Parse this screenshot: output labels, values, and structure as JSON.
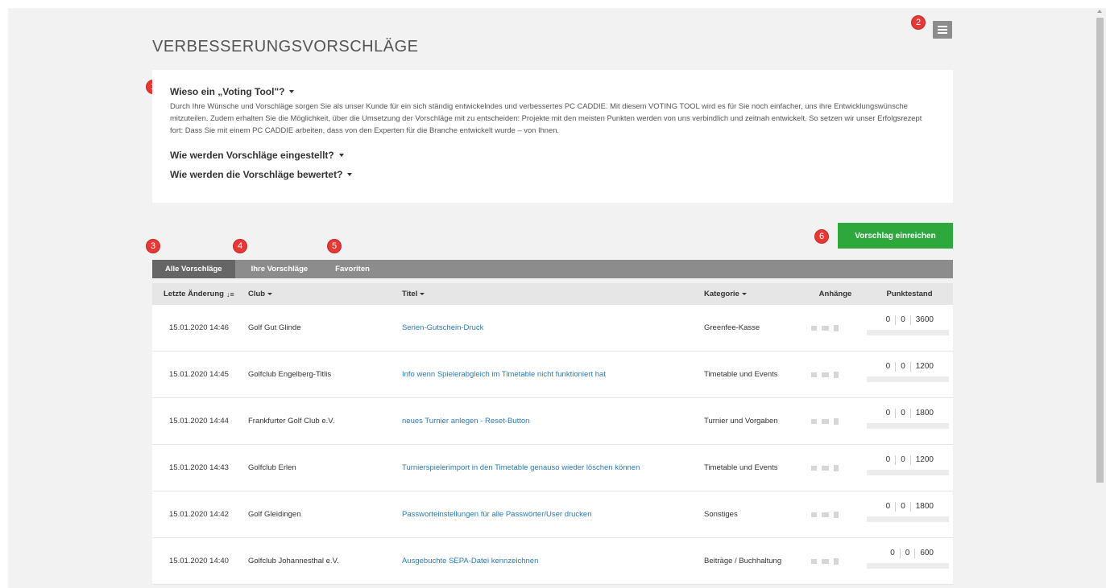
{
  "page": {
    "title": "VERBESSERUNGSVORSCHLÄGE"
  },
  "badges": [
    "1",
    "2",
    "3",
    "4",
    "5",
    "6"
  ],
  "faq": {
    "q1": "Wieso ein „Voting Tool\"?",
    "a1": "Durch Ihre Wünsche und Vorschläge sorgen Sie als unser Kunde für ein sich ständig entwickelndes und verbessertes PC CADDIE. Mit diesem VOTING TOOL wird es für Sie noch einfacher, uns ihre Entwicklungswünsche mitzuteilen. Zudem erhalten Sie die Möglichkeit, über die Umsetzung der Vorschläge mit zu entscheiden: Projekte mit den meisten Punkten werden von uns verbindlich und zeitnah entwickelt. So setzen wir unser Erfolgsrezept fort: Dass Sie mit einem PC CADDIE arbeiten, dass von den Experten für die Branche entwickelt wurde – von Ihnen.",
    "q2": "Wie werden Vorschläge eingestellt?",
    "q3": "Wie werden die Vorschläge bewertet?"
  },
  "submit_label": "Vorschlag einreichen",
  "tabs": [
    {
      "label": "Alle Vorschläge",
      "active": true
    },
    {
      "label": "Ihre Vorschläge",
      "active": false
    },
    {
      "label": "Favoriten",
      "active": false
    }
  ],
  "table": {
    "headers": {
      "date": "Letzte Änderung",
      "club": "Club",
      "title": "Titel",
      "category": "Kategorie",
      "attachments": "Anhänge",
      "points": "Punktestand"
    },
    "rows": [
      {
        "date": "15.01.2020 14:46",
        "club": "Golf Gut Glinde",
        "title": "Serien-Gutschein-Druck",
        "category": "Greenfee-Kasse",
        "p1": "0",
        "p2": "0",
        "p3": "3600",
        "progress": 0
      },
      {
        "date": "15.01.2020 14:45",
        "club": "Golfclub Engelberg-Titlis",
        "title": "Info wenn Spielerabgleich im Timetable nicht funktioniert hat",
        "category": "Timetable und Events",
        "p1": "0",
        "p2": "0",
        "p3": "1200",
        "progress": 0
      },
      {
        "date": "15.01.2020 14:44",
        "club": "Frankfurter Golf Club e.V.",
        "title": "neues Turnier anlegen - Reset-Button",
        "category": "Turnier und Vorgaben",
        "p1": "0",
        "p2": "0",
        "p3": "1800",
        "progress": 0
      },
      {
        "date": "15.01.2020 14:43",
        "club": "Golfclub Erlen",
        "title": "Turnierspielerimport in den Timetable genauso wieder löschen können",
        "category": "Timetable und Events",
        "p1": "0",
        "p2": "0",
        "p3": "1200",
        "progress": 0
      },
      {
        "date": "15.01.2020 14:42",
        "club": "Golf Gleidingen",
        "title": "Passworteinstellungen für alle Passwörter/User drucken",
        "category": "Sonstiges",
        "p1": "0",
        "p2": "0",
        "p3": "1800",
        "progress": 0
      },
      {
        "date": "15.01.2020 14:40",
        "club": "Golfclub Johannesthal e.V.",
        "title": "Ausgebuchte SEPA-Datei kennzeichnen",
        "category": "Beiträge / Buchhaltung",
        "p1": "0",
        "p2": "0",
        "p3": "600",
        "progress": 0
      }
    ]
  },
  "colors": {
    "accent_green": "#2ea83c",
    "badge_red": "#e53935",
    "link_blue": "#2a7ab0",
    "tab_bar": "#8c8c8c"
  }
}
